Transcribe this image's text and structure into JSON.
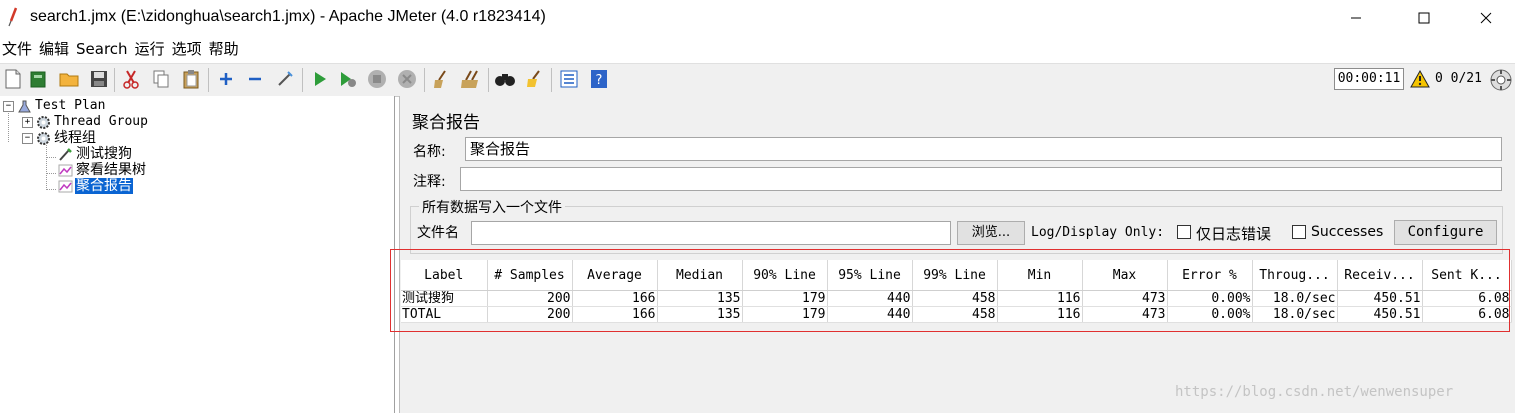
{
  "window": {
    "title": "search1.jmx (E:\\zidonghua\\search1.jmx) - Apache JMeter (4.0 r1823414)"
  },
  "menu": [
    "文件",
    "编辑",
    "Search",
    "运行",
    "选项",
    "帮助"
  ],
  "toolbar": {
    "timer": "00:00:11",
    "counts": "0 0/21"
  },
  "tree": {
    "root": "Test Plan",
    "thread_group": "Thread Group",
    "thread_group_cn": "线程组",
    "sampler": "测试搜狗",
    "result_tree": "察看结果树",
    "aggregate_report": "聚合报告"
  },
  "panel": {
    "title": "聚合报告",
    "name_label": "名称:",
    "name_value": "聚合报告",
    "comment_label": "注释:",
    "comment_value": "",
    "group_title": "所有数据写入一个文件",
    "file_label": "文件名",
    "file_value": "",
    "browse_button": "浏览...",
    "log_display_label": "Log/Display Only:",
    "errors_only_label": "仅日志错误",
    "successes_label": "Successes",
    "configure_button": "Configure"
  },
  "table": {
    "headers": [
      "Label",
      "# Samples",
      "Average",
      "Median",
      "90% Line",
      "95% Line",
      "99% Line",
      "Min",
      "Max",
      "Error %",
      "Throug...",
      "Receiv...",
      "Sent K..."
    ],
    "rows": [
      [
        "测试搜狗",
        "200",
        "166",
        "135",
        "179",
        "440",
        "458",
        "116",
        "473",
        "0.00%",
        "18.0/sec",
        "450.51",
        "6.08"
      ],
      [
        "TOTAL",
        "200",
        "166",
        "135",
        "179",
        "440",
        "458",
        "116",
        "473",
        "0.00%",
        "18.0/sec",
        "450.51",
        "6.08"
      ]
    ]
  },
  "watermark": "https://blog.csdn.net/wenwensuper"
}
